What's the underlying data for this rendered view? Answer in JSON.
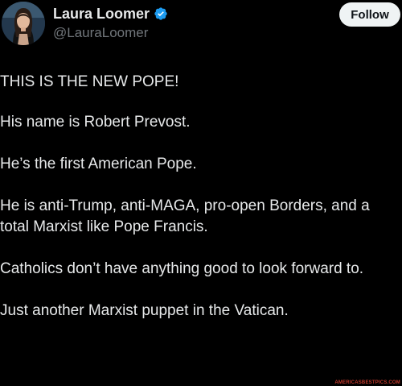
{
  "author": {
    "display_name": "Laura Loomer",
    "handle": "@LauraLoomer",
    "avatar_icon": "profile-photo",
    "verified_icon": "verified-badge-icon",
    "verified_color": "#1d9bf0"
  },
  "actions": {
    "follow_label": "Follow"
  },
  "tweet": {
    "paragraphs": [
      "THIS IS THE NEW POPE!",
      "His name is Robert Prevost.",
      "He’s the first American Pope.",
      "He is anti-Trump, anti-MAGA, pro-open Borders, and a total Marxist like Pope Francis.",
      "Catholics don’t have anything good to look forward to.",
      "Just another Marxist puppet in the Vatican."
    ]
  },
  "watermark": "AMERICASBESTPICS.COM",
  "colors": {
    "background": "#000000",
    "text": "#e7e9ea",
    "secondary_text": "#71767b",
    "button_bg": "#eff3f4",
    "button_text": "#0f1419"
  }
}
